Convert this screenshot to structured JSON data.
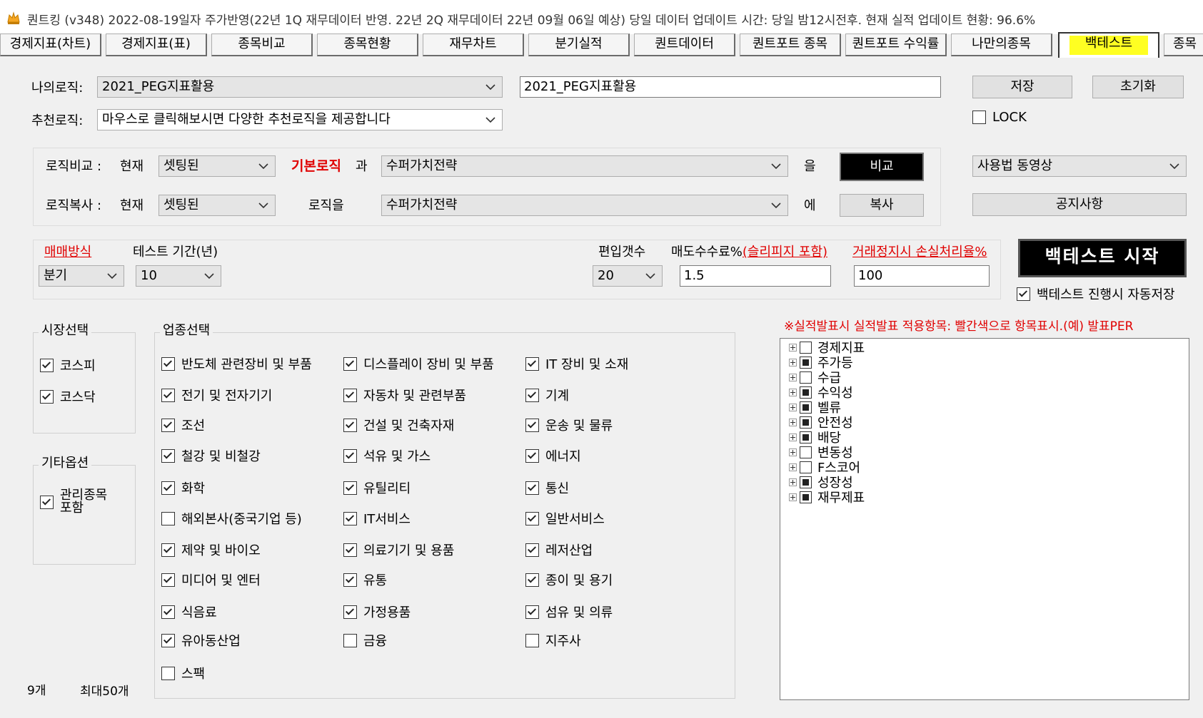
{
  "window": {
    "title": "퀀트킹 (v348) 2022-08-19일자 주가반영(22년 1Q 재무데이터 반영. 22년 2Q 재무데이터 22년 09월 06일 예상)    당일 데이터 업데이트 시간: 당일 밤12시전후.  현재 실적 업데이트 현황: 96.6%"
  },
  "tabs": [
    {
      "label": "경제지표(차트)"
    },
    {
      "label": "경제지표(표)"
    },
    {
      "label": "종목비교"
    },
    {
      "label": "종목현황"
    },
    {
      "label": "재무차트"
    },
    {
      "label": "분기실적"
    },
    {
      "label": "퀀트데이터"
    },
    {
      "label": "퀀트포트 종목"
    },
    {
      "label": "퀀트포트 수익률"
    },
    {
      "label": "나만의종목"
    },
    {
      "label": "백테스트",
      "active": true
    },
    {
      "label": "종목"
    }
  ],
  "logic": {
    "my_logic_label": "나의로직:",
    "my_logic_value": "2021_PEG지표활용",
    "logic_name_value": "2021_PEG지표활용",
    "recommend_label": "추천로직:",
    "recommend_value": "마우스로 클릭해보시면 다양한 추천로직을 제공합니다",
    "save_label": "저장",
    "reset_label": "초기화",
    "lock_label": "LOCK",
    "lock_checked": false
  },
  "compare": {
    "compare_label": "로직비교 :",
    "current_label": "현재",
    "compare_current_value": "셋팅된",
    "basic_logic_label": "기본로직",
    "and_label": "과",
    "compare_target_value": "수퍼가치전략",
    "eul_label": "을",
    "compare_button": "비교",
    "copy_label": "로직복사 :",
    "copy_current_value": "셋팅된",
    "logic_eul_label": "로직을",
    "copy_target_value": "수퍼가치전략",
    "e_label": "에",
    "copy_button": "복사",
    "video_value": "사용법 동영상",
    "notice_button": "공지사항"
  },
  "params": {
    "trade_method_label": "매매방식",
    "trade_method_value": "분기",
    "test_period_label": "테스트 기간(년)",
    "test_period_value": "10",
    "num_stocks_label": "편입갯수",
    "num_stocks_value": "20",
    "fee_label": "매도수수료%",
    "fee_link": "(슬리피지 포함)",
    "fee_value": "1.5",
    "halt_label": "거래정지시 손실처리율%",
    "halt_value": "100",
    "start_button": "백테스트 시작",
    "autosave_label": "백테스트 진행시 자동저장",
    "autosave_checked": true
  },
  "market": {
    "title": "시장선택",
    "items": [
      {
        "label": "코스피",
        "checked": true
      },
      {
        "label": "코스닥",
        "checked": true
      }
    ]
  },
  "other": {
    "title": "기타옵션",
    "items": [
      {
        "label": "관리종목\n포함",
        "checked": true
      }
    ]
  },
  "sectors": {
    "title": "업종선택",
    "col1": [
      {
        "label": "반도체 관련장비 및 부품",
        "checked": true
      },
      {
        "label": "전기 및 전자기기",
        "checked": true
      },
      {
        "label": "조선",
        "checked": true
      },
      {
        "label": "철강 및 비철강",
        "checked": true
      },
      {
        "label": "화학",
        "checked": true
      },
      {
        "label": "해외본사(중국기업 등)",
        "checked": false
      },
      {
        "label": "제약 및 바이오",
        "checked": true
      },
      {
        "label": "미디어 및 엔터",
        "checked": true
      },
      {
        "label": "식음료",
        "checked": true
      },
      {
        "label": "유아동산업",
        "checked": true
      },
      {
        "label": "스팩",
        "checked": false
      }
    ],
    "col2": [
      {
        "label": "디스플레이 장비 및 부품",
        "checked": true
      },
      {
        "label": "자동차 및 관련부품",
        "checked": true
      },
      {
        "label": "건설 및 건축자재",
        "checked": true
      },
      {
        "label": "석유 및 가스",
        "checked": true
      },
      {
        "label": "유틸리티",
        "checked": true
      },
      {
        "label": "IT서비스",
        "checked": true
      },
      {
        "label": "의료기기 및 용품",
        "checked": true
      },
      {
        "label": "유통",
        "checked": true
      },
      {
        "label": "가정용품",
        "checked": true
      },
      {
        "label": "금융",
        "checked": false
      }
    ],
    "col3": [
      {
        "label": "IT 장비 및 소재",
        "checked": true
      },
      {
        "label": "기계",
        "checked": true
      },
      {
        "label": "운송 및 물류",
        "checked": true
      },
      {
        "label": "에너지",
        "checked": true
      },
      {
        "label": "통신",
        "checked": true
      },
      {
        "label": "일반서비스",
        "checked": true
      },
      {
        "label": "레저산업",
        "checked": true
      },
      {
        "label": "종이 및 용기",
        "checked": true
      },
      {
        "label": "섬유 및 의류",
        "checked": true
      },
      {
        "label": "지주사",
        "checked": false
      }
    ]
  },
  "footer": {
    "count": "9개",
    "max": "최대50개"
  },
  "tree": {
    "notice": "※실적발표시 실적발표 적용항목: 빨간색으로 항목표시.(예) 발표PER",
    "items": [
      {
        "label": "경제지표",
        "state": "empty"
      },
      {
        "label": "주가등",
        "state": "filled"
      },
      {
        "label": "수급",
        "state": "empty"
      },
      {
        "label": "수익성",
        "state": "filled"
      },
      {
        "label": "벨류",
        "state": "filled"
      },
      {
        "label": "안전성",
        "state": "filled"
      },
      {
        "label": "배당",
        "state": "filled"
      },
      {
        "label": "변동성",
        "state": "empty"
      },
      {
        "label": "F스코어",
        "state": "empty"
      },
      {
        "label": "성장성",
        "state": "filled"
      },
      {
        "label": "재무제표",
        "state": "filled"
      }
    ]
  }
}
